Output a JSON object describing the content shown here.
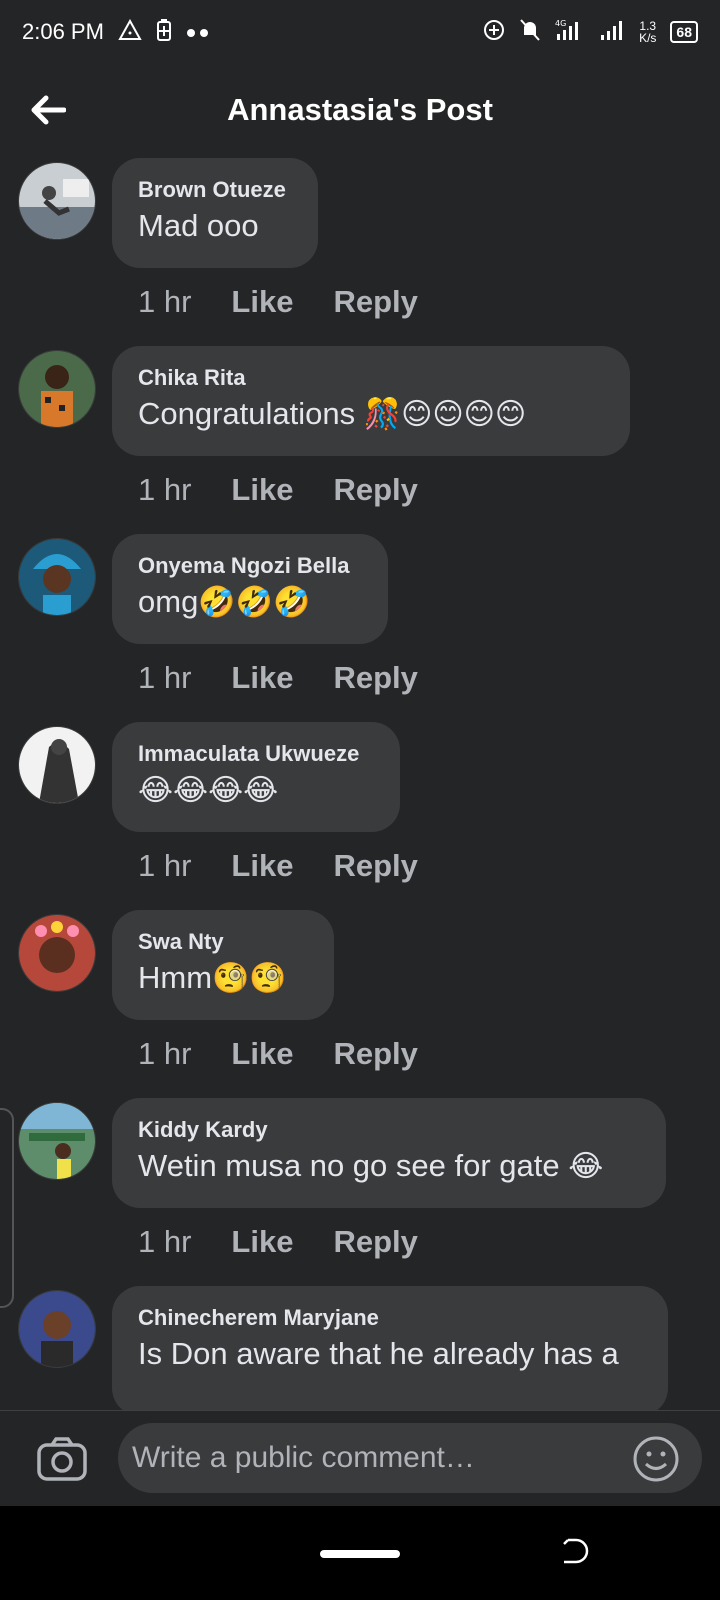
{
  "status_bar": {
    "time": "2:06 PM",
    "network_speed_value": "1.3",
    "network_speed_unit": "K/s",
    "battery": "68",
    "signal_label": "4G"
  },
  "header": {
    "title": "Annastasia's Post"
  },
  "comments": [
    {
      "author": "Brown Otueze",
      "text": "Mad ooo",
      "emoji": "",
      "time": "1 hr",
      "like": "Like",
      "reply": "Reply"
    },
    {
      "author": "Chika Rita",
      "text": "Congratulations ",
      "emoji": "🎊😊😊😊😊",
      "time": "1 hr",
      "like": "Like",
      "reply": "Reply"
    },
    {
      "author": "Onyema Ngozi Bella",
      "text": "omg",
      "emoji": "🤣🤣🤣",
      "time": "1 hr",
      "like": "Like",
      "reply": "Reply"
    },
    {
      "author": "Immaculata Ukwueze",
      "text": "",
      "emoji": "😂😂😂😂",
      "time": "1 hr",
      "like": "Like",
      "reply": "Reply"
    },
    {
      "author": "Swa Nty",
      "text": "Hmm",
      "emoji": "🧐🧐",
      "time": "1 hr",
      "like": "Like",
      "reply": "Reply"
    },
    {
      "author": "Kiddy Kardy",
      "text": "Wetin musa no go see for gate ",
      "emoji": "😂",
      "time": "1 hr",
      "like": "Like",
      "reply": "Reply"
    },
    {
      "author": "Chinecherem Maryjane",
      "text": "Is Don aware that he already has a",
      "emoji": "",
      "time": "",
      "like": "",
      "reply": ""
    }
  ],
  "composer": {
    "placeholder": "Write a public comment…"
  },
  "colors": {
    "background": "#242526",
    "bubble": "#3a3b3c",
    "primary_text": "#e4e6eb",
    "secondary_text": "#b0b3b8"
  },
  "icons": {
    "back": "arrow-left-icon",
    "camera": "camera-icon",
    "emoji": "smiley-icon"
  }
}
